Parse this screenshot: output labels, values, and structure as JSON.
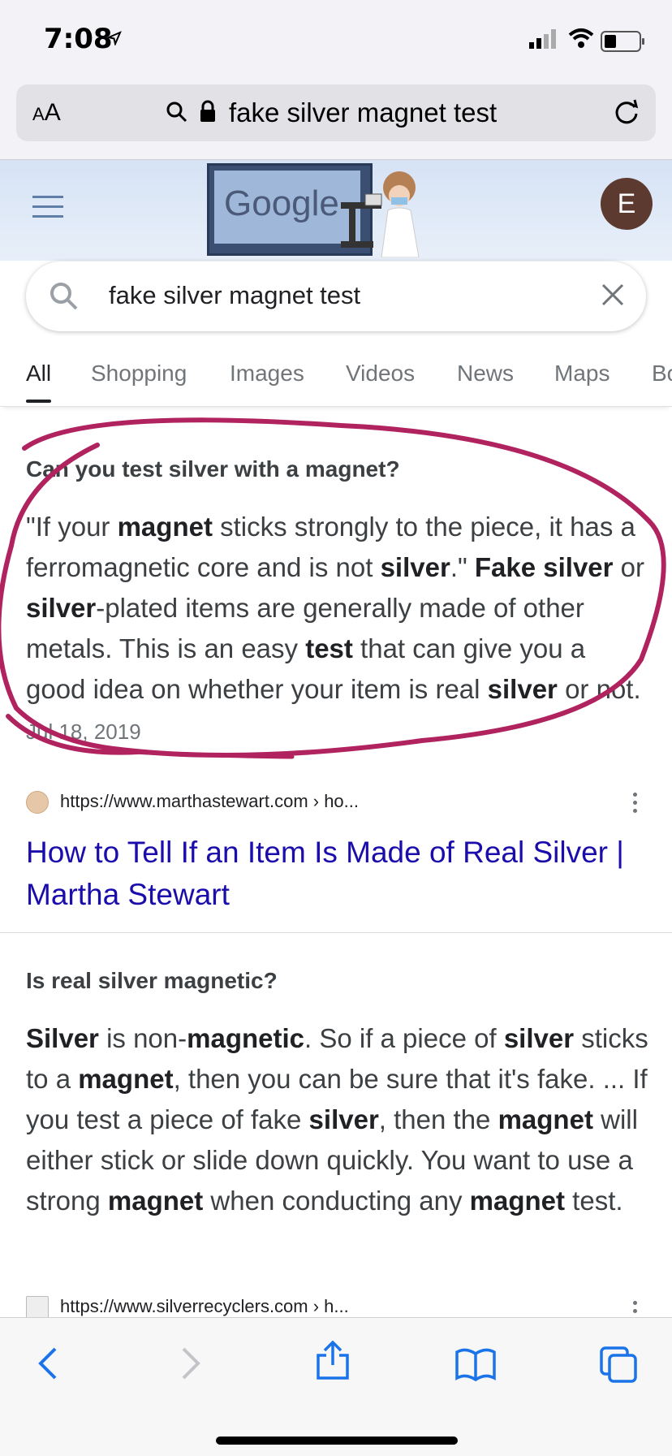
{
  "status": {
    "time": "7:08"
  },
  "address_bar": {
    "aa_label_small": "A",
    "aa_label_large": "A",
    "url_text": "fake silver magnet test"
  },
  "header": {
    "avatar_letter": "E",
    "doodle_text": "Google"
  },
  "search": {
    "query": "fake silver magnet test"
  },
  "tabs": [
    {
      "label": "All",
      "active": true
    },
    {
      "label": "Shopping"
    },
    {
      "label": "Images"
    },
    {
      "label": "Videos"
    },
    {
      "label": "News"
    },
    {
      "label": "Maps"
    },
    {
      "label": "Bo"
    }
  ],
  "results": [
    {
      "question": "Can you test silver with a magnet?",
      "snippet_parts": [
        {
          "t": "\"If your "
        },
        {
          "t": "magnet",
          "b": true
        },
        {
          "t": " sticks strongly to the piece, it has a ferromagnetic core and is not "
        },
        {
          "t": "silver",
          "b": true
        },
        {
          "t": ".\" "
        },
        {
          "t": "Fake silver",
          "b": true
        },
        {
          "t": " or "
        },
        {
          "t": "silver",
          "b": true
        },
        {
          "t": "-plated items are generally made of other metals. This is an easy "
        },
        {
          "t": "test",
          "b": true
        },
        {
          "t": " that can give you a good idea on whether your item is real "
        },
        {
          "t": "silver",
          "b": true
        },
        {
          "t": " or not. "
        }
      ],
      "date": "Jul 18, 2019",
      "source": "https://www.marthastewart.com › ho...",
      "title": "How to Tell If an Item Is Made of Real Silver | Martha Stewart"
    },
    {
      "question": "Is real silver magnetic?",
      "snippet_parts": [
        {
          "t": "Silver",
          "b": true
        },
        {
          "t": " is non-"
        },
        {
          "t": "magnetic",
          "b": true
        },
        {
          "t": ". So if a piece of "
        },
        {
          "t": "silver",
          "b": true
        },
        {
          "t": " sticks to a "
        },
        {
          "t": "magnet",
          "b": true
        },
        {
          "t": ", then you can be sure that it's fake. ... If you test a piece of fake "
        },
        {
          "t": "silver",
          "b": true
        },
        {
          "t": ", then the "
        },
        {
          "t": "magnet",
          "b": true
        },
        {
          "t": " will either stick or slide down quickly. You want to use a strong "
        },
        {
          "t": "magnet",
          "b": true
        },
        {
          "t": " when conducting any "
        },
        {
          "t": "magnet",
          "b": true
        },
        {
          "t": " test."
        }
      ],
      "source": "https://www.silverrecyclers.com › h..."
    }
  ],
  "colors": {
    "annotation": "#b0235f",
    "link": "#1a0dab"
  }
}
